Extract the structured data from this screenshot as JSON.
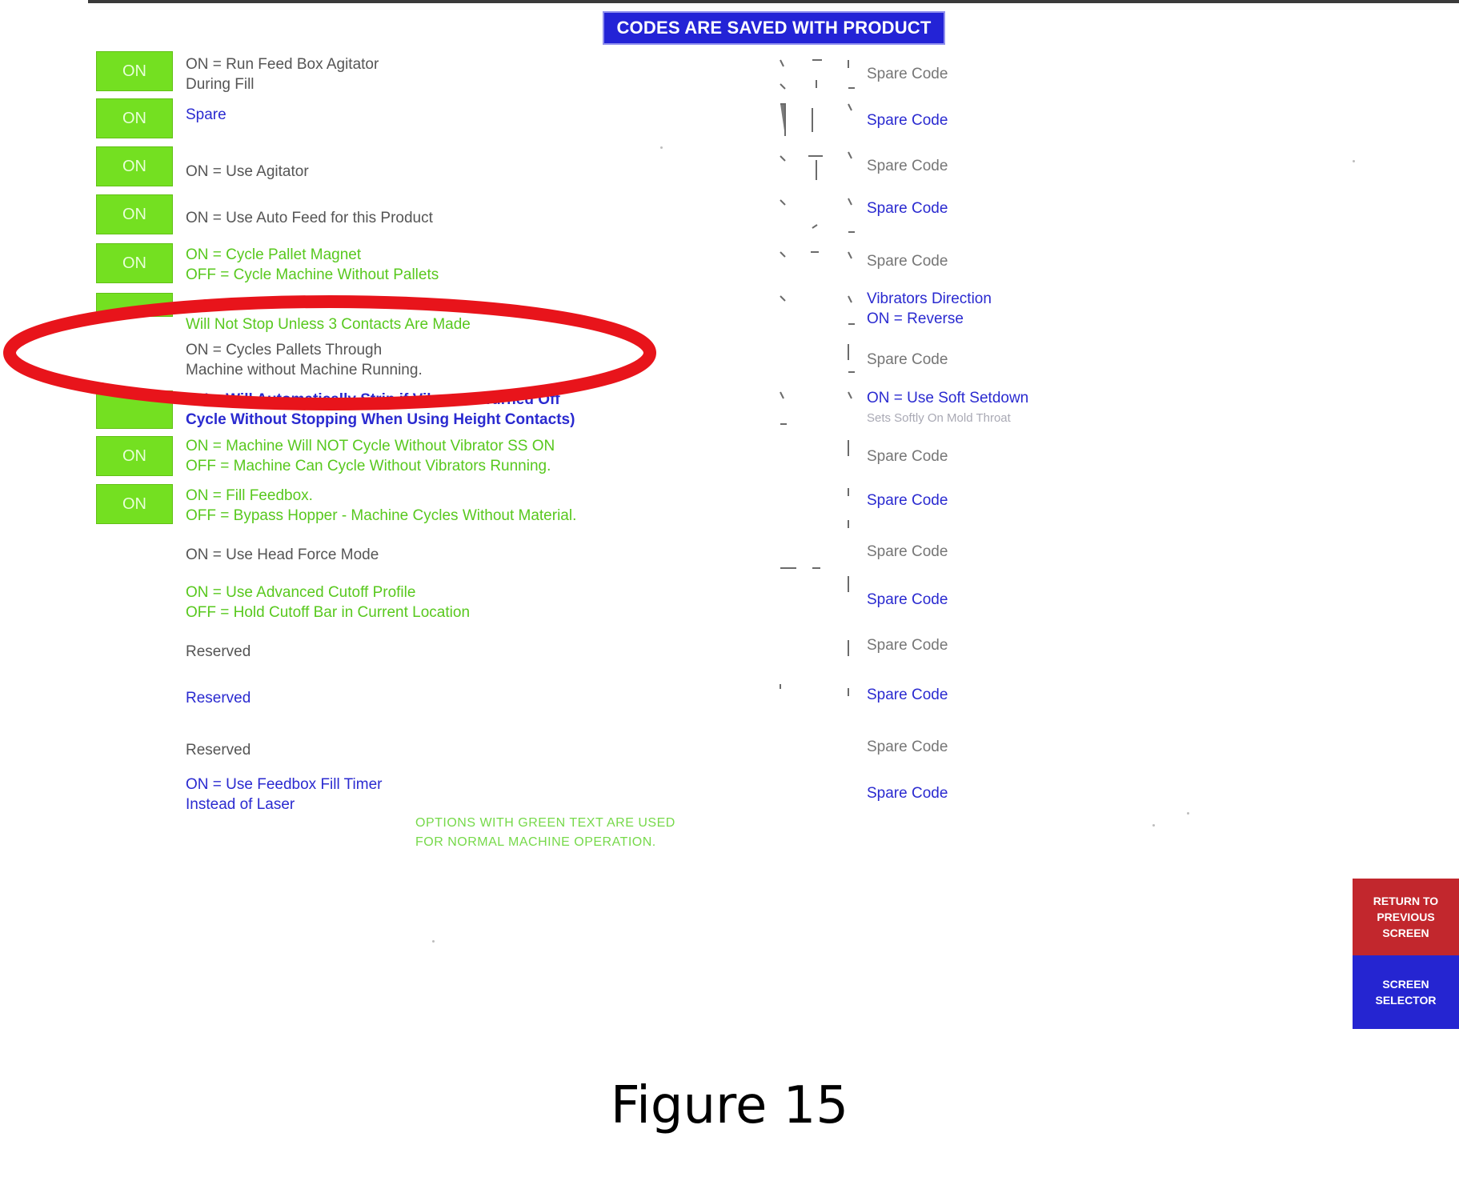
{
  "header": {
    "banner": "CODES ARE SAVED WITH PRODUCT"
  },
  "toggles": [
    {
      "label": "ON"
    },
    {
      "label": "ON"
    },
    {
      "label": "ON"
    },
    {
      "label": "ON"
    },
    {
      "label": "ON"
    },
    {
      "label": ""
    },
    {
      "label": ""
    },
    {
      "label": "ON"
    },
    {
      "label": "ON"
    }
  ],
  "options": [
    {
      "line1": "ON = Run Feed Box Agitator",
      "line2": "During Fill",
      "color": "gray"
    },
    {
      "line1": "Spare",
      "line2": "",
      "color": "blue"
    },
    {
      "line1": "ON = Use Agitator",
      "line2": "",
      "color": "gray"
    },
    {
      "line1": "ON = Use Auto Feed for this Product",
      "line2": "",
      "color": "gray"
    },
    {
      "line1": "ON = Cycle Pallet Magnet",
      "line2": "OFF = Cycle Machine Without Pallets",
      "color": "green"
    },
    {
      "line1": "Will Not Stop Unless 3 Contacts Are Made",
      "line2": "",
      "color": "green"
    },
    {
      "line1": "ON = Cycles Pallets Through",
      "line2": "Machine without Machine Running.",
      "color": "gray"
    },
    {
      "line1": "ON = Will Automatically Strip if Vibrators Turned Off",
      "line2": "Cycle Without Stopping When Using Height Contacts)",
      "color": "blue"
    },
    {
      "line1": "ON = Machine Will NOT Cycle Without Vibrator SS ON",
      "line2": "OFF = Machine Can Cycle Without Vibrators Running.",
      "color": "green"
    },
    {
      "line1": "ON = Fill Feedbox.",
      "line2": "OFF = Bypass Hopper - Machine Cycles Without Material.",
      "color": "green"
    },
    {
      "line1": "ON = Use Head Force Mode",
      "line2": "",
      "color": "gray"
    },
    {
      "line1": "ON = Use Advanced Cutoff Profile",
      "line2": "OFF = Hold Cutoff Bar in Current Location",
      "color": "green"
    },
    {
      "line1": "Reserved",
      "line2": "",
      "color": "gray"
    },
    {
      "line1": "Reserved",
      "line2": "",
      "color": "blue"
    },
    {
      "line1": "Reserved",
      "line2": "",
      "color": "gray"
    },
    {
      "line1": "ON = Use Feedbox Fill Timer",
      "line2": "Instead of Laser",
      "color": "blue"
    }
  ],
  "right_codes": [
    {
      "line1": "Spare Code",
      "line2": "",
      "color": "gray"
    },
    {
      "line1": "Spare Code",
      "line2": "",
      "color": "blue"
    },
    {
      "line1": "Spare Code",
      "line2": "",
      "color": "gray"
    },
    {
      "line1": "Spare Code",
      "line2": "",
      "color": "blue"
    },
    {
      "line1": "Spare Code",
      "line2": "",
      "color": "gray"
    },
    {
      "line1": "Vibrators Direction",
      "line2": "ON = Reverse",
      "color": "blue"
    },
    {
      "line1": "Spare Code",
      "line2": "",
      "color": "gray"
    },
    {
      "line1": "ON = Use Soft Setdown",
      "line2": "Sets Softly On Mold Throat",
      "color": "blue"
    },
    {
      "line1": "Spare Code",
      "line2": "",
      "color": "gray"
    },
    {
      "line1": "Spare Code",
      "line2": "",
      "color": "blue"
    },
    {
      "line1": "Spare Code",
      "line2": "",
      "color": "gray"
    },
    {
      "line1": "Spare Code",
      "line2": "",
      "color": "blue"
    },
    {
      "line1": "Spare Code",
      "line2": "",
      "color": "gray"
    },
    {
      "line1": "Spare Code",
      "line2": "",
      "color": "blue"
    },
    {
      "line1": "Spare Code",
      "line2": "",
      "color": "gray"
    },
    {
      "line1": "Spare Code",
      "line2": "",
      "color": "blue"
    }
  ],
  "footer_note": {
    "line1": "OPTIONS WITH GREEN TEXT ARE USED",
    "line2": "FOR NORMAL MACHINE OPERATION."
  },
  "buttons": {
    "return_previous": "RETURN TO PREVIOUS SCREEN",
    "screen_selector": "SCREEN SELECTOR"
  },
  "caption": "Figure 15",
  "colors": {
    "toggle_on": "#74e021",
    "header_banner": "#2323d6",
    "highlight_ring": "#e8141b",
    "return_button": "#c2272d",
    "selector_button": "#2525d1"
  }
}
